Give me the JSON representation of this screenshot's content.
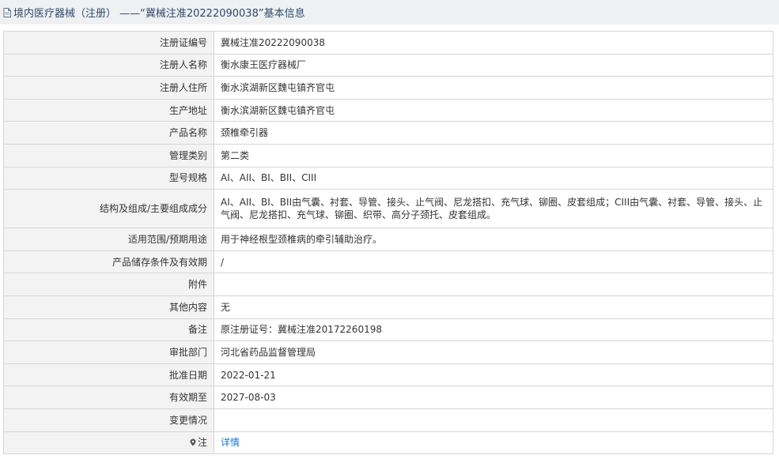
{
  "header": {
    "title": "境内医疗器械（注册） ——“冀械注准20222090038”基本信息"
  },
  "rows": [
    {
      "label": "注册证编号",
      "value": "冀械注准20222090038"
    },
    {
      "label": "注册人名称",
      "value": "衡水康王医疗器械厂"
    },
    {
      "label": "注册人住所",
      "value": "衡水滨湖新区魏屯镇齐官屯"
    },
    {
      "label": "生产地址",
      "value": "衡水滨湖新区魏屯镇齐官屯"
    },
    {
      "label": "产品名称",
      "value": "颈椎牵引器"
    },
    {
      "label": "管理类别",
      "value": "第二类"
    },
    {
      "label": "型号规格",
      "value": "AI、AII、BI、BII、CIII"
    },
    {
      "label": "结构及组成/主要组成成分",
      "value": "AI、AII、BI、BII由气囊、衬套、导管、接头、止气阀、尼龙搭扣、充气球、铆圈、皮套组成；CIII由气囊、衬套、导管、接头、止气阀、尼龙搭扣、充气球、铆圈、织带、高分子颈托、皮套组成。"
    },
    {
      "label": "适用范围/预期用途",
      "value": "用于神经根型颈椎病的牵引辅助治疗。"
    },
    {
      "label": "产品储存条件及有效期",
      "value": "/"
    },
    {
      "label": "附件",
      "value": ""
    },
    {
      "label": "其他内容",
      "value": "无"
    },
    {
      "label": "备注",
      "value": "原注册证号：冀械注准20172260198"
    },
    {
      "label": "审批部门",
      "value": "河北省药品监督管理局"
    },
    {
      "label": "批准日期",
      "value": "2022-01-21"
    },
    {
      "label": "有效期至",
      "value": "2027-08-03"
    },
    {
      "label": "变更情况",
      "value": ""
    },
    {
      "label": "注",
      "value": "详情"
    }
  ]
}
